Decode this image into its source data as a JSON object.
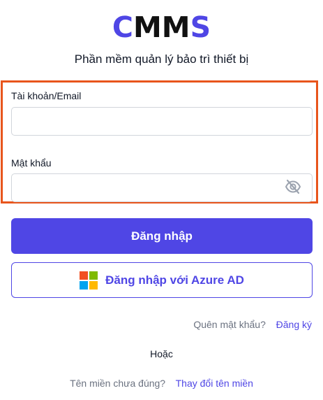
{
  "logo": {
    "letters": [
      "C",
      "M",
      "M",
      "S"
    ],
    "colors": [
      "#4f46e5",
      "#111111",
      "#111111",
      "#4f46e5"
    ]
  },
  "subtitle": "Phần mềm quản lý bảo trì thiết bị",
  "form": {
    "account_label": "Tài khoản/Email",
    "account_value": "",
    "password_label": "Mật khẩu",
    "password_value": "",
    "password_toggle_icon": "eye-off-icon"
  },
  "buttons": {
    "login_label": "Đăng nhập",
    "azure_label": "Đăng nhập với Azure AD",
    "azure_icon": "microsoft-logo-icon"
  },
  "links": {
    "forgot_password": "Quên mật khẩu?",
    "register": "Đăng ký"
  },
  "or_text": "Hoặc",
  "domain": {
    "prompt": "Tên miền chưa đúng?",
    "change_link": "Thay đổi tên miền"
  },
  "colors": {
    "primary": "#4f46e5",
    "highlight_border": "#e8551c",
    "muted_text": "#6b7280",
    "ms_red": "#f25022",
    "ms_green": "#7fba00",
    "ms_blue": "#00a4ef",
    "ms_yellow": "#ffb900"
  }
}
